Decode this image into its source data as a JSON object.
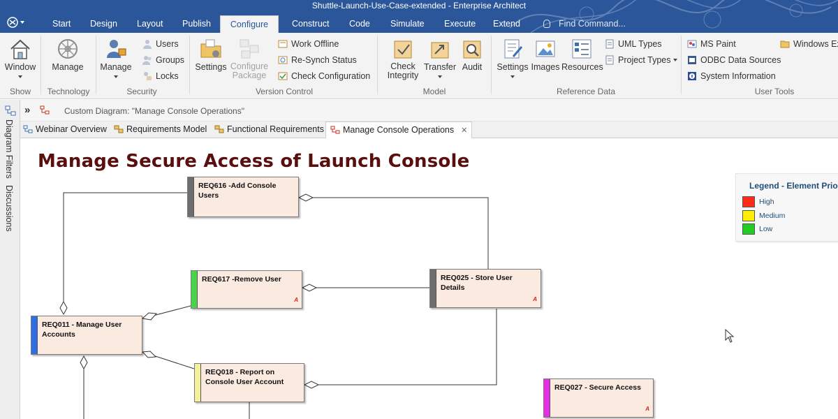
{
  "window": {
    "title": "Shuttle-Launch-Use-Case-extended - Enterprise Architect"
  },
  "ribbon_tabs": [
    "Start",
    "Design",
    "Layout",
    "Publish",
    "Configure",
    "Construct",
    "Code",
    "Simulate",
    "Execute",
    "Extend"
  ],
  "active_tab": "Configure",
  "find_command": {
    "placeholder": "Find Command..."
  },
  "ribbon": {
    "show": {
      "window": "Window",
      "label": "Show"
    },
    "technology": {
      "manage": "Manage",
      "label": "Technology"
    },
    "security": {
      "manage": "Manage",
      "users": "Users",
      "groups": "Groups",
      "locks": "Locks",
      "label": "Security"
    },
    "version_control": {
      "settings": "Settings",
      "configure_package": "Configure Package",
      "work_offline": "Work Offline",
      "resynch": "Re-Synch Status",
      "check_config": "Check Configuration",
      "label": "Version Control"
    },
    "model": {
      "check_integrity": "Check Integrity",
      "transfer": "Transfer",
      "audit": "Audit",
      "label": "Model"
    },
    "reference_data": {
      "settings": "Settings",
      "images": "Images",
      "resources": "Resources",
      "uml_types": "UML Types",
      "project_types": "Project Types",
      "label": "Reference Data"
    },
    "user_tools": {
      "ms_paint": "MS Paint",
      "odbc": "ODBC Data Sources",
      "system_info": "System Information",
      "windows_explorer": "Windows Ex",
      "label": "User Tools"
    }
  },
  "left_panel": {
    "diagram_filters": "Diagram Filters",
    "discussions": "Discussions"
  },
  "breadcrumb": "Custom Diagram: \"Manage Console Operations\"",
  "doc_tabs": [
    "Webinar Overview",
    "Requirements Model",
    "Functional Requirements",
    "Manage Console Operations"
  ],
  "active_doc_tab": "Manage Console Operations",
  "diagram": {
    "title": "Manage Secure Access of Launch Console",
    "nodes": [
      {
        "id": "req616",
        "name": "REQ616 -Add Console Users",
        "priority_color": "#6e6e6e",
        "tag": ""
      },
      {
        "id": "req617",
        "name": "REQ617 -Remove User",
        "priority_color": "#4cd24c",
        "tag": "A"
      },
      {
        "id": "req025",
        "name": "REQ025 - Store User Details",
        "priority_color": "#6e6e6e",
        "tag": "A"
      },
      {
        "id": "req011",
        "name": "REQ011 - Manage User Accounts",
        "priority_color": "#2f6fe6",
        "tag": ""
      },
      {
        "id": "req018",
        "name": "REQ018 - Report on Console User Account",
        "priority_color": "#f6f09a",
        "tag": ""
      },
      {
        "id": "req027",
        "name": "REQ027 - Secure Access",
        "priority_color": "#e62ee6",
        "tag": "A"
      }
    ]
  },
  "legend": {
    "title": "Legend - Element Prio",
    "items": [
      {
        "label": "High",
        "color": "#ff2a1a"
      },
      {
        "label": "Medium",
        "color": "#ffee00"
      },
      {
        "label": "Low",
        "color": "#22cc22"
      }
    ]
  }
}
